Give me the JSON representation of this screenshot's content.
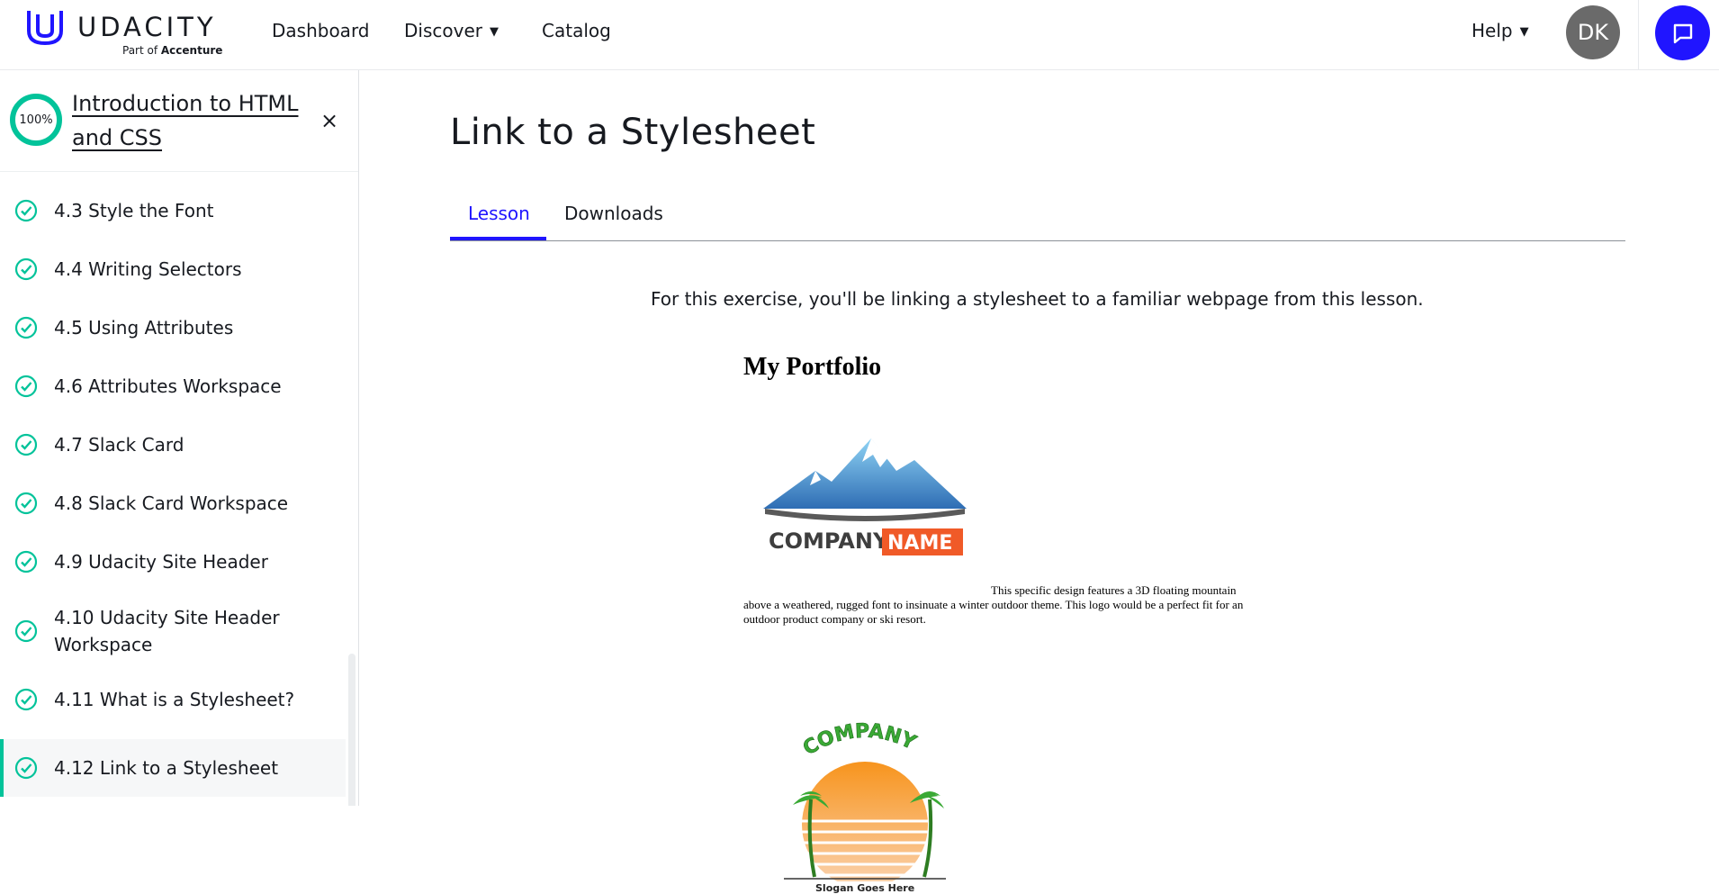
{
  "brand": {
    "name": "UDACITY",
    "sub_prefix": "Part of ",
    "sub_strong": "Accenture"
  },
  "nav": {
    "dashboard": "Dashboard",
    "discover": "Discover",
    "catalog": "Catalog",
    "help": "Help",
    "avatar_initials": "DK"
  },
  "sidebar": {
    "progress": "100%",
    "course_title": "Introduction to HTML and CSS",
    "close": "×",
    "lessons": [
      {
        "label": "4.3  Style the Font",
        "status": "complete"
      },
      {
        "label": "4.4  Writing Selectors",
        "status": "complete"
      },
      {
        "label": "4.5  Using Attributes",
        "status": "complete"
      },
      {
        "label": "4.6  Attributes Workspace",
        "status": "complete"
      },
      {
        "label": "4.7  Slack Card",
        "status": "complete"
      },
      {
        "label": "4.8  Slack Card Workspace",
        "status": "complete"
      },
      {
        "label": "4.9  Udacity Site Header",
        "status": "complete"
      },
      {
        "label": "4.10  Udacity Site Header Workspace",
        "status": "complete"
      },
      {
        "label": "4.11  What is a Stylesheet?",
        "status": "complete"
      },
      {
        "label": "4.12  Link to a Stylesheet",
        "status": "complete",
        "active": true
      }
    ]
  },
  "main": {
    "title": "Link to a Stylesheet",
    "tabs": [
      {
        "label": "Lesson",
        "active": true
      },
      {
        "label": "Downloads",
        "active": false
      }
    ],
    "intro": "For this exercise, you'll be linking a stylesheet to a familiar webpage from this lesson.",
    "portfolio": {
      "title": "My Portfolio",
      "logo1_text_a": "COMPANY",
      "logo1_text_b": "NAME",
      "description": "This specific design features a 3D floating mountain above a weathered, rugged font to insinuate a winter outdoor theme. This logo would be a perfect fit for an outdoor product company or ski resort.",
      "logo2_arc_text": "COMPANY",
      "logo2_slogan": "Slogan Goes Here"
    }
  },
  "colors": {
    "accent": "#2015ff",
    "success": "#02c39a",
    "text": "#171a20"
  }
}
